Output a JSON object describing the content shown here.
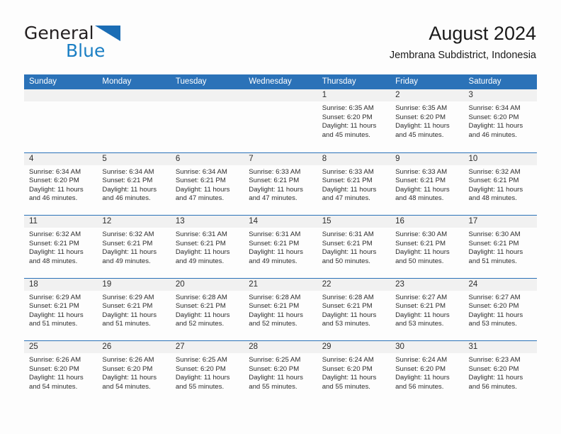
{
  "brand": {
    "name_top": "General",
    "name_bottom": "Blue",
    "triangle_icon": "triangle-icon",
    "color_dark": "#231f20",
    "color_blue": "#1b7fc4"
  },
  "header": {
    "title": "August 2024",
    "subtitle": "Jembrana Subdistrict, Indonesia"
  },
  "theme": {
    "header_bg": "#2b72b8",
    "header_text": "#ffffff",
    "daynum_band_bg": "#f1f1f1",
    "row_divider": "#2b72b8",
    "page_bg": "#fdfdfd"
  },
  "calendar": {
    "day_headers": [
      "Sunday",
      "Monday",
      "Tuesday",
      "Wednesday",
      "Thursday",
      "Friday",
      "Saturday"
    ],
    "weeks": [
      [
        {
          "day": ""
        },
        {
          "day": ""
        },
        {
          "day": ""
        },
        {
          "day": ""
        },
        {
          "day": "1",
          "sunrise": "Sunrise: 6:35 AM",
          "sunset": "Sunset: 6:20 PM",
          "daylight_1": "Daylight: 11 hours",
          "daylight_2": "and 45 minutes."
        },
        {
          "day": "2",
          "sunrise": "Sunrise: 6:35 AM",
          "sunset": "Sunset: 6:20 PM",
          "daylight_1": "Daylight: 11 hours",
          "daylight_2": "and 45 minutes."
        },
        {
          "day": "3",
          "sunrise": "Sunrise: 6:34 AM",
          "sunset": "Sunset: 6:20 PM",
          "daylight_1": "Daylight: 11 hours",
          "daylight_2": "and 46 minutes."
        }
      ],
      [
        {
          "day": "4",
          "sunrise": "Sunrise: 6:34 AM",
          "sunset": "Sunset: 6:20 PM",
          "daylight_1": "Daylight: 11 hours",
          "daylight_2": "and 46 minutes."
        },
        {
          "day": "5",
          "sunrise": "Sunrise: 6:34 AM",
          "sunset": "Sunset: 6:21 PM",
          "daylight_1": "Daylight: 11 hours",
          "daylight_2": "and 46 minutes."
        },
        {
          "day": "6",
          "sunrise": "Sunrise: 6:34 AM",
          "sunset": "Sunset: 6:21 PM",
          "daylight_1": "Daylight: 11 hours",
          "daylight_2": "and 47 minutes."
        },
        {
          "day": "7",
          "sunrise": "Sunrise: 6:33 AM",
          "sunset": "Sunset: 6:21 PM",
          "daylight_1": "Daylight: 11 hours",
          "daylight_2": "and 47 minutes."
        },
        {
          "day": "8",
          "sunrise": "Sunrise: 6:33 AM",
          "sunset": "Sunset: 6:21 PM",
          "daylight_1": "Daylight: 11 hours",
          "daylight_2": "and 47 minutes."
        },
        {
          "day": "9",
          "sunrise": "Sunrise: 6:33 AM",
          "sunset": "Sunset: 6:21 PM",
          "daylight_1": "Daylight: 11 hours",
          "daylight_2": "and 48 minutes."
        },
        {
          "day": "10",
          "sunrise": "Sunrise: 6:32 AM",
          "sunset": "Sunset: 6:21 PM",
          "daylight_1": "Daylight: 11 hours",
          "daylight_2": "and 48 minutes."
        }
      ],
      [
        {
          "day": "11",
          "sunrise": "Sunrise: 6:32 AM",
          "sunset": "Sunset: 6:21 PM",
          "daylight_1": "Daylight: 11 hours",
          "daylight_2": "and 48 minutes."
        },
        {
          "day": "12",
          "sunrise": "Sunrise: 6:32 AM",
          "sunset": "Sunset: 6:21 PM",
          "daylight_1": "Daylight: 11 hours",
          "daylight_2": "and 49 minutes."
        },
        {
          "day": "13",
          "sunrise": "Sunrise: 6:31 AM",
          "sunset": "Sunset: 6:21 PM",
          "daylight_1": "Daylight: 11 hours",
          "daylight_2": "and 49 minutes."
        },
        {
          "day": "14",
          "sunrise": "Sunrise: 6:31 AM",
          "sunset": "Sunset: 6:21 PM",
          "daylight_1": "Daylight: 11 hours",
          "daylight_2": "and 49 minutes."
        },
        {
          "day": "15",
          "sunrise": "Sunrise: 6:31 AM",
          "sunset": "Sunset: 6:21 PM",
          "daylight_1": "Daylight: 11 hours",
          "daylight_2": "and 50 minutes."
        },
        {
          "day": "16",
          "sunrise": "Sunrise: 6:30 AM",
          "sunset": "Sunset: 6:21 PM",
          "daylight_1": "Daylight: 11 hours",
          "daylight_2": "and 50 minutes."
        },
        {
          "day": "17",
          "sunrise": "Sunrise: 6:30 AM",
          "sunset": "Sunset: 6:21 PM",
          "daylight_1": "Daylight: 11 hours",
          "daylight_2": "and 51 minutes."
        }
      ],
      [
        {
          "day": "18",
          "sunrise": "Sunrise: 6:29 AM",
          "sunset": "Sunset: 6:21 PM",
          "daylight_1": "Daylight: 11 hours",
          "daylight_2": "and 51 minutes."
        },
        {
          "day": "19",
          "sunrise": "Sunrise: 6:29 AM",
          "sunset": "Sunset: 6:21 PM",
          "daylight_1": "Daylight: 11 hours",
          "daylight_2": "and 51 minutes."
        },
        {
          "day": "20",
          "sunrise": "Sunrise: 6:28 AM",
          "sunset": "Sunset: 6:21 PM",
          "daylight_1": "Daylight: 11 hours",
          "daylight_2": "and 52 minutes."
        },
        {
          "day": "21",
          "sunrise": "Sunrise: 6:28 AM",
          "sunset": "Sunset: 6:21 PM",
          "daylight_1": "Daylight: 11 hours",
          "daylight_2": "and 52 minutes."
        },
        {
          "day": "22",
          "sunrise": "Sunrise: 6:28 AM",
          "sunset": "Sunset: 6:21 PM",
          "daylight_1": "Daylight: 11 hours",
          "daylight_2": "and 53 minutes."
        },
        {
          "day": "23",
          "sunrise": "Sunrise: 6:27 AM",
          "sunset": "Sunset: 6:21 PM",
          "daylight_1": "Daylight: 11 hours",
          "daylight_2": "and 53 minutes."
        },
        {
          "day": "24",
          "sunrise": "Sunrise: 6:27 AM",
          "sunset": "Sunset: 6:20 PM",
          "daylight_1": "Daylight: 11 hours",
          "daylight_2": "and 53 minutes."
        }
      ],
      [
        {
          "day": "25",
          "sunrise": "Sunrise: 6:26 AM",
          "sunset": "Sunset: 6:20 PM",
          "daylight_1": "Daylight: 11 hours",
          "daylight_2": "and 54 minutes."
        },
        {
          "day": "26",
          "sunrise": "Sunrise: 6:26 AM",
          "sunset": "Sunset: 6:20 PM",
          "daylight_1": "Daylight: 11 hours",
          "daylight_2": "and 54 minutes."
        },
        {
          "day": "27",
          "sunrise": "Sunrise: 6:25 AM",
          "sunset": "Sunset: 6:20 PM",
          "daylight_1": "Daylight: 11 hours",
          "daylight_2": "and 55 minutes."
        },
        {
          "day": "28",
          "sunrise": "Sunrise: 6:25 AM",
          "sunset": "Sunset: 6:20 PM",
          "daylight_1": "Daylight: 11 hours",
          "daylight_2": "and 55 minutes."
        },
        {
          "day": "29",
          "sunrise": "Sunrise: 6:24 AM",
          "sunset": "Sunset: 6:20 PM",
          "daylight_1": "Daylight: 11 hours",
          "daylight_2": "and 55 minutes."
        },
        {
          "day": "30",
          "sunrise": "Sunrise: 6:24 AM",
          "sunset": "Sunset: 6:20 PM",
          "daylight_1": "Daylight: 11 hours",
          "daylight_2": "and 56 minutes."
        },
        {
          "day": "31",
          "sunrise": "Sunrise: 6:23 AM",
          "sunset": "Sunset: 6:20 PM",
          "daylight_1": "Daylight: 11 hours",
          "daylight_2": "and 56 minutes."
        }
      ]
    ]
  }
}
